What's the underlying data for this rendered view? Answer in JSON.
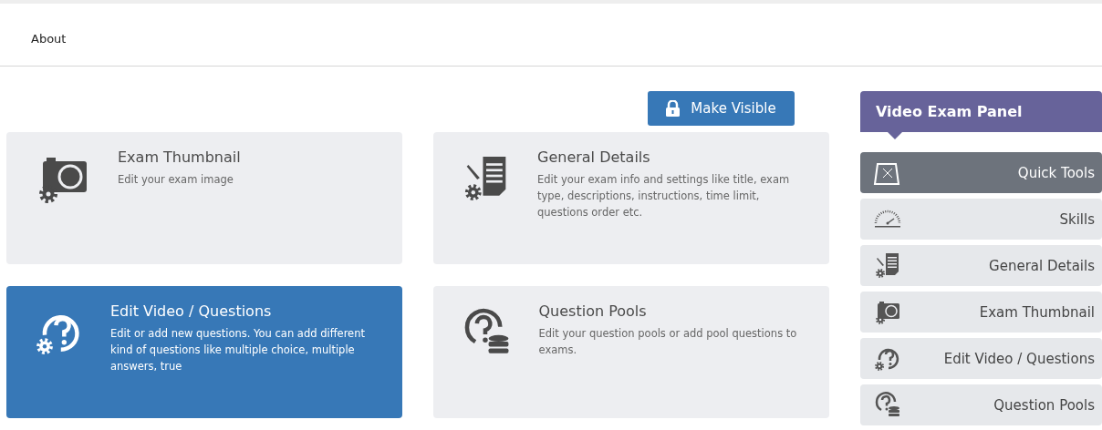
{
  "nav": {
    "items": [
      "About"
    ]
  },
  "make_visible": {
    "label": "Make Visible"
  },
  "cards": [
    {
      "kind": "camera",
      "title": "Exam Thumbnail",
      "description": "Edit your exam image",
      "selected": false
    },
    {
      "kind": "document",
      "title": "General Details",
      "description": "Edit your exam info and settings like title, exam type, descriptions, instructions, time limit, questions order etc.",
      "selected": false
    },
    {
      "kind": "question",
      "title": "Edit Video / Questions",
      "description": "Edit or add new questions. You can add different kind of questions like multiple choice, multiple answers, true",
      "selected": true
    },
    {
      "kind": "pool",
      "title": "Question Pools",
      "description": "Edit your question pools or add pool questions to exams.",
      "selected": false
    }
  ],
  "panel": {
    "title": "Video Exam Panel",
    "items": [
      {
        "kind": "keyboard",
        "label": "Quick Tools",
        "selected": true
      },
      {
        "kind": "gauge",
        "label": "Skills",
        "selected": false
      },
      {
        "kind": "document",
        "label": "General Details",
        "selected": false
      },
      {
        "kind": "camera",
        "label": "Exam Thumbnail",
        "selected": false
      },
      {
        "kind": "question",
        "label": "Edit Video / Questions",
        "selected": false
      },
      {
        "kind": "pool",
        "label": "Question Pools",
        "selected": false
      }
    ]
  }
}
